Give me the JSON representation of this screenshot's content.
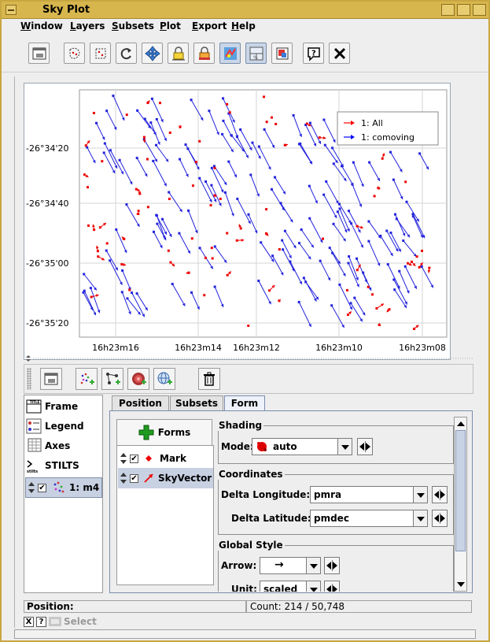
{
  "window": {
    "title": "Sky Plot"
  },
  "menubar": [
    "Window",
    "Layers",
    "Subsets",
    "Plot",
    "Export",
    "Help"
  ],
  "toolbar": {
    "icons": [
      "window-icon",
      "region-icon",
      "drag-region-icon",
      "replot-icon",
      "navigate-icon",
      "lock-axes-icon",
      "lock-aspect-icon",
      "sketch-icon",
      "axis-grid-icon",
      "export-image-icon",
      "help-icon",
      "close-icon"
    ]
  },
  "plot": {
    "y_ticks": [
      "-26°34'20",
      "-26°34'40",
      "-26°35'00",
      "-26°35'20"
    ],
    "x_ticks": [
      "16h23m16",
      "16h23m14",
      "16h23m12",
      "16h23m10",
      "16h23m08"
    ],
    "legend": [
      {
        "label": "1: All",
        "color": "#ff0000"
      },
      {
        "label": "1: comoving",
        "color": "#0000ff"
      }
    ]
  },
  "controls": {
    "items": [
      "Frame",
      "Legend",
      "Axes",
      "STILTS"
    ],
    "layer": "1: m4"
  },
  "tabs": [
    "Position",
    "Subsets",
    "Form"
  ],
  "form": {
    "forms_button": "Forms",
    "list": [
      {
        "label": "Mark",
        "checked": "✔"
      },
      {
        "label": "SkyVector",
        "checked": "✔"
      }
    ],
    "shading": {
      "legend": "Shading",
      "mode_label": "Mode:",
      "mode_value": "auto"
    },
    "coordinates": {
      "legend": "Coordinates",
      "dlon_label": "Delta Longitude:",
      "dlon_value": "pmra",
      "dlat_label": "Delta Latitude:",
      "dlat_value": "pmdec"
    },
    "global_style": {
      "legend": "Global Style",
      "arrow_label": "Arrow:",
      "arrow_value": "→",
      "unit_label": "Unit:",
      "unit_value": "scaled"
    }
  },
  "status": {
    "position": "Position:",
    "count": "Count: 214 / 50,748",
    "select_label": "Select",
    "x_btn": "X",
    "help_btn": "?"
  }
}
